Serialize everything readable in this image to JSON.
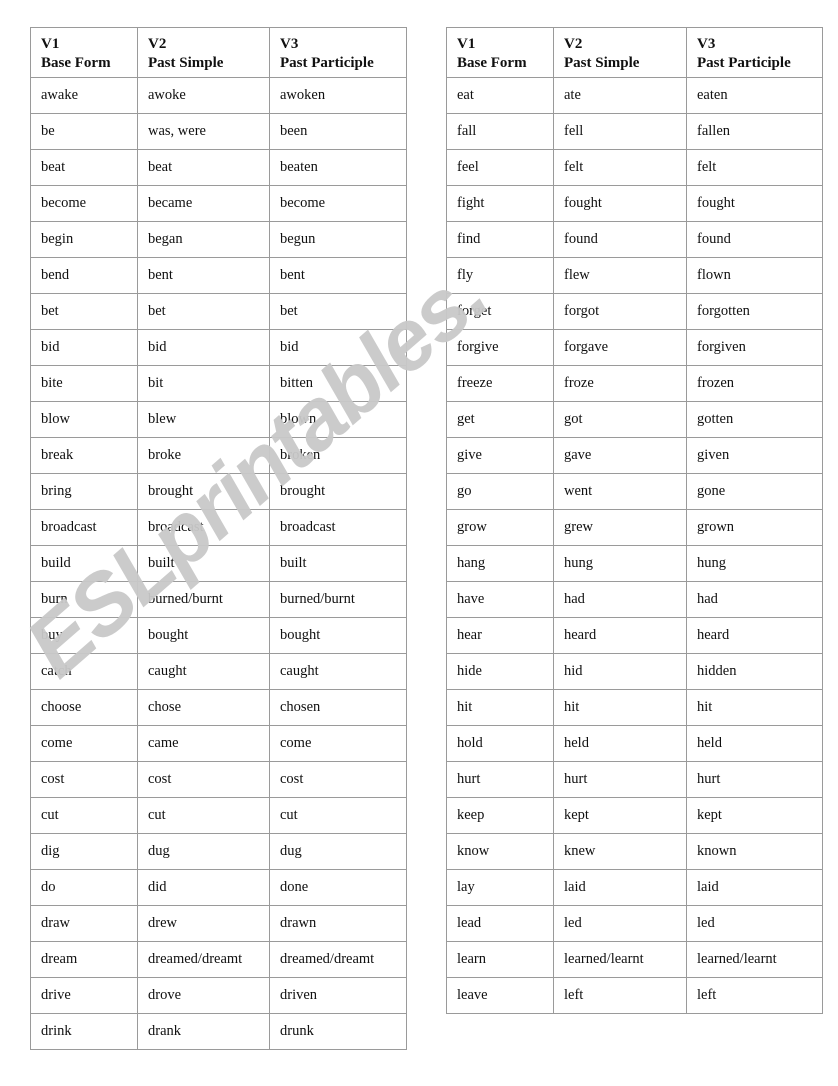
{
  "columns": [
    {
      "code": "V1",
      "name": "Base Form"
    },
    {
      "code": "V2",
      "name": "Past Simple"
    },
    {
      "code": "V3",
      "name": "Past Participle"
    }
  ],
  "watermark": {
    "text": "ESLprintables.",
    "color": "#c9c9c9"
  },
  "colors": {
    "border": "#9a9a9a",
    "text": "#101010",
    "background": "#ffffff"
  },
  "left_table": {
    "rows": [
      [
        "awake",
        "awoke",
        "awoken"
      ],
      [
        "be",
        "was, were",
        "been"
      ],
      [
        "beat",
        "beat",
        "beaten"
      ],
      [
        "become",
        "became",
        "become"
      ],
      [
        "begin",
        "began",
        "begun"
      ],
      [
        "bend",
        "bent",
        "bent"
      ],
      [
        "bet",
        "bet",
        "bet"
      ],
      [
        "bid",
        "bid",
        "bid"
      ],
      [
        "bite",
        "bit",
        "bitten"
      ],
      [
        "blow",
        "blew",
        "blown"
      ],
      [
        "break",
        "broke",
        "broken"
      ],
      [
        "bring",
        "brought",
        "brought"
      ],
      [
        "broadcast",
        "broadcast",
        "broadcast"
      ],
      [
        "build",
        "built",
        "built"
      ],
      [
        "burn",
        "burned/burnt",
        "burned/burnt"
      ],
      [
        "buy",
        "bought",
        "bought"
      ],
      [
        "catch",
        "caught",
        "caught"
      ],
      [
        "choose",
        "chose",
        "chosen"
      ],
      [
        "come",
        "came",
        "come"
      ],
      [
        "cost",
        "cost",
        "cost"
      ],
      [
        "cut",
        "cut",
        "cut"
      ],
      [
        "dig",
        "dug",
        "dug"
      ],
      [
        "do",
        "did",
        "done"
      ],
      [
        "draw",
        "drew",
        "drawn"
      ],
      [
        "dream",
        "dreamed/dreamt",
        "dreamed/dreamt"
      ],
      [
        "drive",
        "drove",
        "driven"
      ],
      [
        "drink",
        "drank",
        "drunk"
      ]
    ]
  },
  "right_table": {
    "rows": [
      [
        "eat",
        "ate",
        "eaten"
      ],
      [
        "fall",
        "fell",
        "fallen"
      ],
      [
        "feel",
        "felt",
        "felt"
      ],
      [
        "fight",
        "fought",
        "fought"
      ],
      [
        "find",
        "found",
        "found"
      ],
      [
        "fly",
        "flew",
        "flown"
      ],
      [
        "forget",
        "forgot",
        "forgotten"
      ],
      [
        "forgive",
        "forgave",
        "forgiven"
      ],
      [
        "freeze",
        "froze",
        "frozen"
      ],
      [
        "get",
        "got",
        "gotten"
      ],
      [
        "give",
        "gave",
        "given"
      ],
      [
        "go",
        "went",
        "gone"
      ],
      [
        "grow",
        "grew",
        "grown"
      ],
      [
        "hang",
        "hung",
        "hung"
      ],
      [
        "have",
        "had",
        "had"
      ],
      [
        "hear",
        "heard",
        "heard"
      ],
      [
        "hide",
        "hid",
        "hidden"
      ],
      [
        "hit",
        "hit",
        "hit"
      ],
      [
        "hold",
        "held",
        "held"
      ],
      [
        "hurt",
        "hurt",
        "hurt"
      ],
      [
        "keep",
        "kept",
        "kept"
      ],
      [
        "know",
        "knew",
        "known"
      ],
      [
        "lay",
        "laid",
        "laid"
      ],
      [
        "lead",
        "led",
        "led"
      ],
      [
        "learn",
        "learned/learnt",
        "learned/learnt"
      ],
      [
        "leave",
        "left",
        "left"
      ]
    ]
  }
}
